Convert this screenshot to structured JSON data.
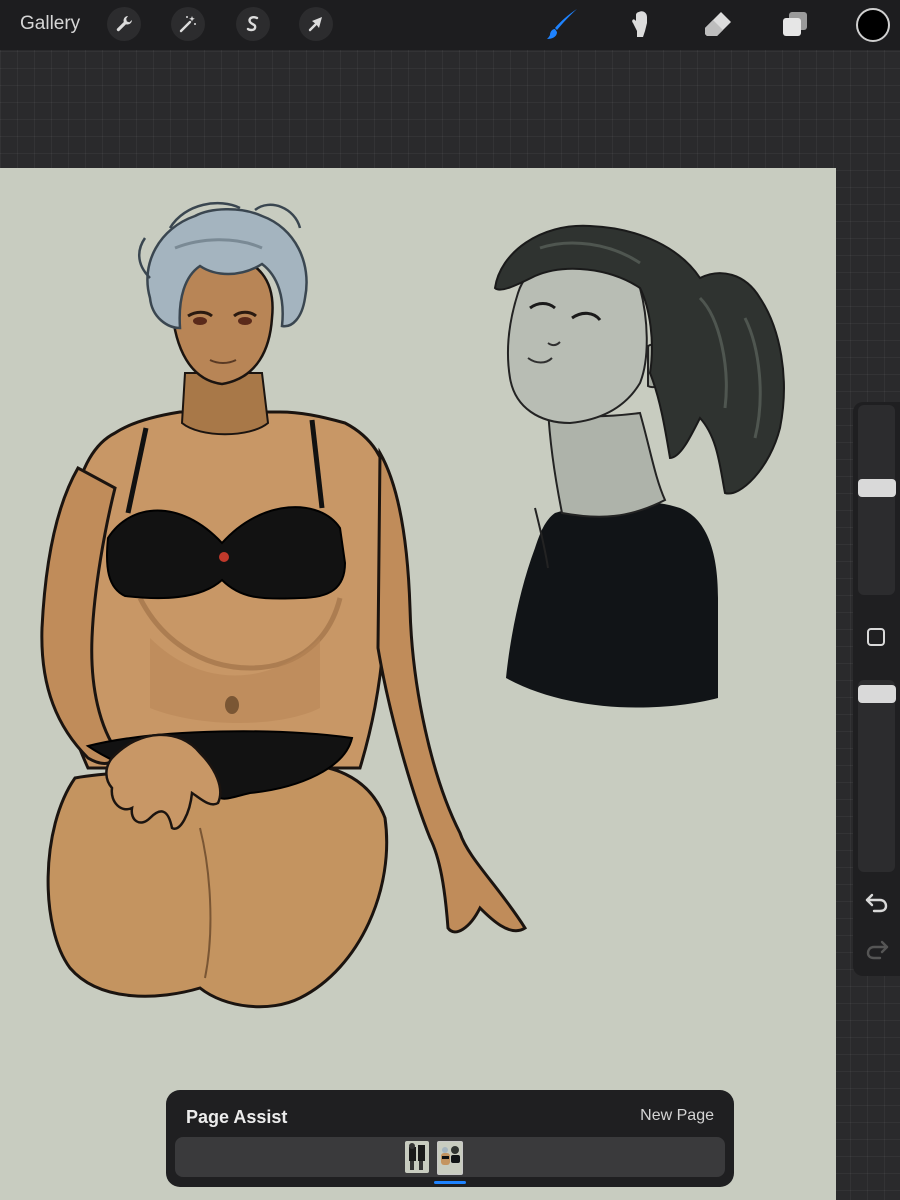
{
  "toolbar": {
    "gallery_label": "Gallery",
    "left_tools": [
      "wrench-icon",
      "magic-wand-icon",
      "selection-icon",
      "transform-arrow-icon"
    ],
    "right_tools": [
      "brush-icon",
      "smudge-icon",
      "eraser-icon",
      "layers-icon"
    ],
    "active_tool": "brush",
    "accent_color": "#1e83ff",
    "current_color": "#000000"
  },
  "sidebar": {
    "brush_size": 0.55,
    "opacity": 0.95,
    "icons": [
      "modify-square-icon",
      "undo-icon",
      "redo-icon"
    ]
  },
  "canvas": {
    "background_color": "#c8ccc0",
    "artwork": [
      "figure-drawing",
      "portrait-sketch"
    ]
  },
  "page_assist": {
    "title": "Page Assist",
    "new_page_label": "New Page",
    "pages": [
      "page-1",
      "page-2"
    ],
    "current_page": 2
  }
}
